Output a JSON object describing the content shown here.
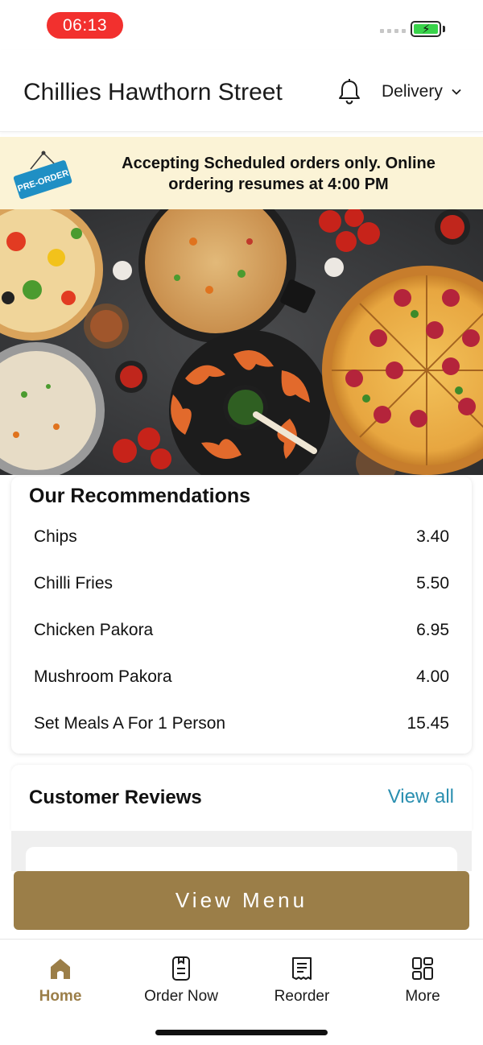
{
  "status_bar": {
    "time": "06:13"
  },
  "header": {
    "title": "Chillies Hawthorn Street",
    "mode": "Delivery"
  },
  "banner": {
    "sign_text": "PRE-ORDER",
    "message": "Accepting Scheduled orders only. Online ordering resumes at 4:00 PM"
  },
  "recommendations": {
    "title": "Our Recommendations",
    "items": [
      {
        "name": "Chips",
        "price": "3.40"
      },
      {
        "name": "Chilli Fries",
        "price": "5.50"
      },
      {
        "name": "Chicken Pakora",
        "price": "6.95"
      },
      {
        "name": "Mushroom Pakora",
        "price": "4.00"
      },
      {
        "name": "Set Meals A For 1 Person",
        "price": "15.45"
      }
    ]
  },
  "reviews": {
    "title": "Customer Reviews",
    "view_all": "View all"
  },
  "view_menu_label": "View Menu",
  "tabs": [
    {
      "label": "Home",
      "icon": "home-icon",
      "active": true
    },
    {
      "label": "Order Now",
      "icon": "order-icon",
      "active": false
    },
    {
      "label": "Reorder",
      "icon": "receipt-icon",
      "active": false
    },
    {
      "label": "More",
      "icon": "grid-icon",
      "active": false
    }
  ],
  "colors": {
    "accent": "#9b7e48",
    "link": "#2a8fb0",
    "banner": "#fbf3d6",
    "time_pill": "#f2302e"
  }
}
